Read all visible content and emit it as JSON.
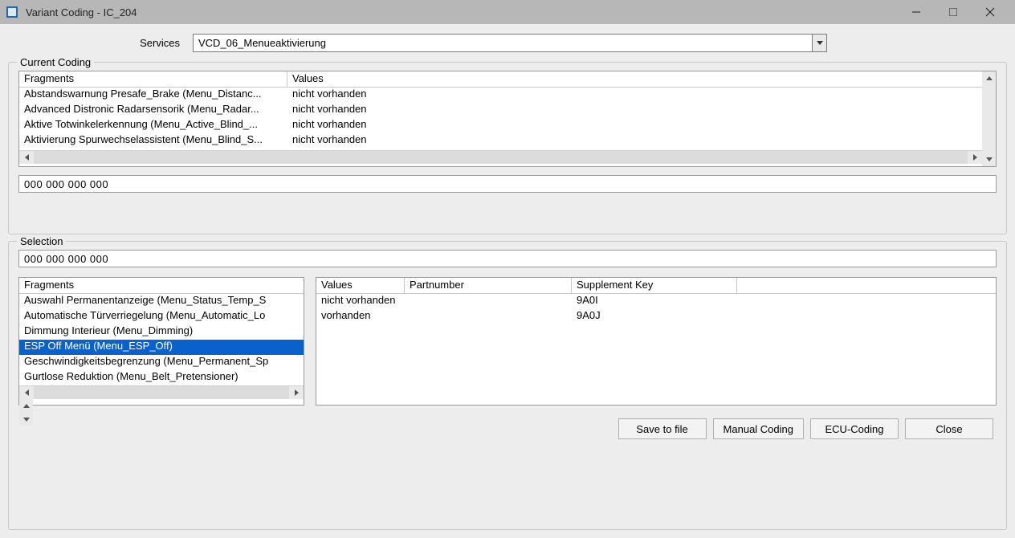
{
  "window": {
    "title": "Variant Coding - IC_204"
  },
  "services": {
    "label": "Services",
    "value": "VCD_06_Menueaktivierung"
  },
  "current_coding": {
    "legend": "Current Coding",
    "columns": {
      "fragments": "Fragments",
      "values": "Values"
    },
    "rows": [
      {
        "fragment": "Abstandswarnung Presafe_Brake (Menu_Distanc...",
        "value": "nicht vorhanden"
      },
      {
        "fragment": "Advanced Distronic Radarsensorik (Menu_Radar...",
        "value": "nicht vorhanden"
      },
      {
        "fragment": "Aktive Totwinkelerkennung (Menu_Active_Blind_...",
        "value": "nicht vorhanden"
      },
      {
        "fragment": "Aktivierung Spurwechselassistent (Menu_Blind_S...",
        "value": "nicht vorhanden"
      }
    ],
    "hex": "000 000 000 000"
  },
  "selection": {
    "legend": "Selection",
    "hex": "000 000 000 000",
    "fragments_header": "Fragments",
    "fragments": [
      {
        "label": "Auswahl Permanentanzeige (Menu_Status_Temp_S",
        "selected": false
      },
      {
        "label": "Automatische Türverriegelung (Menu_Automatic_Lo",
        "selected": false
      },
      {
        "label": "Dimmung Interieur (Menu_Dimming)",
        "selected": false
      },
      {
        "label": "ESP Off Menü (Menu_ESP_Off)",
        "selected": true
      },
      {
        "label": "Geschwindigkeitsbegrenzung (Menu_Permanent_Sp",
        "selected": false
      },
      {
        "label": "Gurtlose Reduktion (Menu_Belt_Pretensioner)",
        "selected": false
      }
    ],
    "values_table": {
      "columns": {
        "values": "Values",
        "partnumber": "Partnumber",
        "supplement": "Supplement Key"
      },
      "rows": [
        {
          "value": "nicht vorhanden",
          "partnumber": "",
          "supplement": "9A0I"
        },
        {
          "value": "vorhanden",
          "partnumber": "",
          "supplement": "9A0J"
        }
      ]
    }
  },
  "buttons": {
    "save": "Save to file",
    "manual": "Manual Coding",
    "ecu": "ECU-Coding",
    "close": "Close"
  }
}
